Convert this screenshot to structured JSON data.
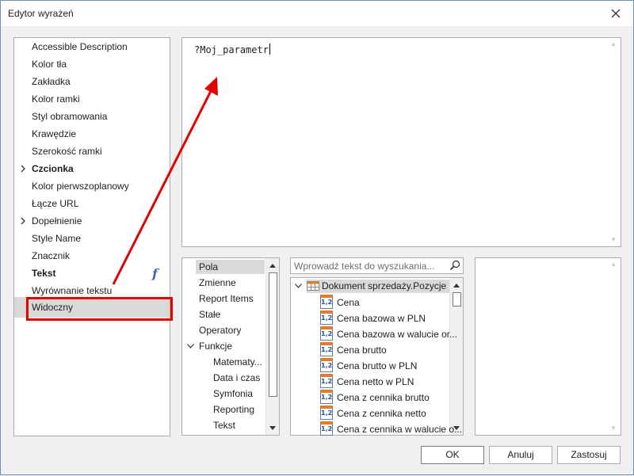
{
  "window": {
    "title": "Edytor wyrażeń"
  },
  "properties": {
    "items": [
      {
        "label": "Accessible Description",
        "bold": false,
        "expandable": false
      },
      {
        "label": "Kolor tła",
        "bold": false,
        "expandable": false
      },
      {
        "label": "Zakładka",
        "bold": false,
        "expandable": false
      },
      {
        "label": "Kolor ramki",
        "bold": false,
        "expandable": false
      },
      {
        "label": "Styl obramowania",
        "bold": false,
        "expandable": false
      },
      {
        "label": "Krawędzie",
        "bold": false,
        "expandable": false
      },
      {
        "label": "Szerokość ramki",
        "bold": false,
        "expandable": false
      },
      {
        "label": "Czcionka",
        "bold": true,
        "expandable": true
      },
      {
        "label": "Kolor pierwszoplanowy",
        "bold": false,
        "expandable": false
      },
      {
        "label": "Łącze URL",
        "bold": false,
        "expandable": false
      },
      {
        "label": "Dopełnienie",
        "bold": false,
        "expandable": true
      },
      {
        "label": "Style Name",
        "bold": false,
        "expandable": false
      },
      {
        "label": "Znacznik",
        "bold": false,
        "expandable": false
      },
      {
        "label": "Tekst",
        "bold": true,
        "expandable": false
      },
      {
        "label": "Wyrównanie tekstu",
        "bold": false,
        "expandable": false
      },
      {
        "label": "Widoczny",
        "bold": false,
        "expandable": false
      }
    ],
    "selected_index": 15,
    "function_icon": "f"
  },
  "editor": {
    "expression": "?Moj_parametr"
  },
  "categories": {
    "items": [
      {
        "label": "Pola",
        "level": 0,
        "selected": true
      },
      {
        "label": "Zmienne",
        "level": 0
      },
      {
        "label": "Report Items",
        "level": 0
      },
      {
        "label": "Stałe",
        "level": 0
      },
      {
        "label": "Operatory",
        "level": 0
      },
      {
        "label": "Funkcje",
        "level": 0,
        "expanded": true
      },
      {
        "label": "Matematy...",
        "level": 1
      },
      {
        "label": "Data i czas",
        "level": 1
      },
      {
        "label": "Symfonia",
        "level": 1
      },
      {
        "label": "Reporting",
        "level": 1
      },
      {
        "label": "Tekst",
        "level": 1
      }
    ]
  },
  "search": {
    "placeholder": "Wprowadź tekst do wyszukania..."
  },
  "fields": {
    "root": "Dokument sprzedaży.Pozycje",
    "items": [
      {
        "label": "Cena",
        "icon": "1,2"
      },
      {
        "label": "Cena bazowa w PLN",
        "icon": "1,2"
      },
      {
        "label": "Cena bazowa w walucie or...",
        "icon": "1,2"
      },
      {
        "label": "Cena brutto",
        "icon": "1,2"
      },
      {
        "label": "Cena brutto w PLN",
        "icon": "1,2"
      },
      {
        "label": "Cena netto w PLN",
        "icon": "1,2"
      },
      {
        "label": "Cena z cennika brutto",
        "icon": "1,2"
      },
      {
        "label": "Cena z cennika netto",
        "icon": "1,2"
      },
      {
        "label": "Cena z cennika w walucie o...",
        "icon": "1,2"
      }
    ]
  },
  "buttons": {
    "ok": "OK",
    "cancel": "Anuluj",
    "apply": "Zastosuj"
  },
  "colors": {
    "annotation": "#e00000",
    "selection": "#d9d9d9",
    "accent_orange": "#e07c2a"
  }
}
